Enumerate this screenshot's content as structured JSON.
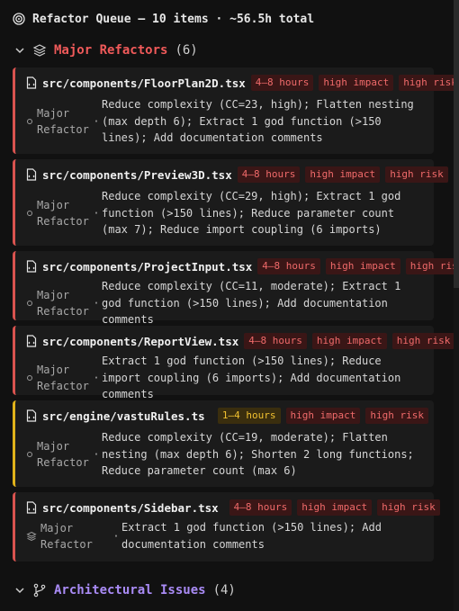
{
  "header": {
    "title": "Refactor Queue — 10 items · ~56.5h total",
    "icon": "target-icon"
  },
  "sections": [
    {
      "title": "Major Refactors",
      "count": "(6)",
      "color": "#f05a5a",
      "icon": "layers-icon"
    },
    {
      "title": "Architectural Issues",
      "count": "(4)",
      "color": "#a98bf5",
      "icon": "git-branch-icon"
    }
  ],
  "cards": [
    {
      "path": "src/components/FloorPlan2D.tsx",
      "time": "4–8 hours",
      "impact": "high impact",
      "risk": "high risk",
      "category": "Major\nRefactor",
      "description": "Reduce complexity (CC=23, high); Flatten nesting (max depth 6); Extract 1 god function (>150 lines); Add documentation comments",
      "accent": "#d9534f"
    },
    {
      "path": "src/components/Preview3D.tsx",
      "time": "4–8 hours",
      "impact": "high impact",
      "risk": "high risk",
      "category": "Major\nRefactor",
      "description": "Reduce complexity (CC=29, high); Extract 1 god function (>150 lines); Reduce parameter count (max 7); Reduce import coupling (6 imports)",
      "accent": "#d9534f"
    },
    {
      "path": "src/components/ProjectInput.tsx",
      "time": "4–8 hours",
      "impact": "high impact",
      "risk": "high risk",
      "category": "Major\nRefactor",
      "description": "Reduce complexity (CC=11, moderate); Extract 1 god function (>150 lines); Add documentation comments",
      "accent": "#d9534f"
    },
    {
      "path": "src/components/ReportView.tsx",
      "time": "4–8 hours",
      "impact": "high impact",
      "risk": "high risk",
      "category": "Major\nRefactor",
      "description": "Extract 1 god function (>150 lines); Reduce import coupling (6 imports); Add documentation comments",
      "accent": "#d9534f"
    },
    {
      "path": "src/engine/vastuRules.ts",
      "time": "1–4 hours",
      "impact": "high impact",
      "risk": "high risk",
      "category": "Major\nRefactor",
      "description": "Reduce complexity (CC=19, moderate); Flatten nesting (max depth 6); Shorten 2 long functions; Reduce parameter count (max 6)",
      "accent": "#e0b21a"
    },
    {
      "path": "src/components/Sidebar.tsx",
      "time": "4–8 hours",
      "impact": "high impact",
      "risk": "high risk",
      "category": "Major\nRefactor",
      "description": "Extract 1 god function (>150 lines); Add documentation comments",
      "accent": "#d9534f"
    }
  ]
}
